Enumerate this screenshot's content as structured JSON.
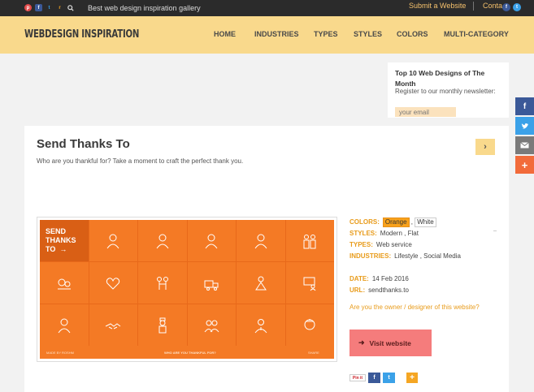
{
  "topbar": {
    "tagline": "Best web design inspiration gallery",
    "submit": "Submit a Website",
    "contact": "Conta"
  },
  "header": {
    "logo": "WEBDESIGN INSPIRATION",
    "nav": [
      "HOME",
      "INDUSTRIES",
      "TYPES",
      "STYLES",
      "COLORS",
      "MULTI-CATEGORY"
    ]
  },
  "newsletter": {
    "title": "Top 10 Web Designs of The Month",
    "text": "Register to our monthly newsletter:",
    "placeholder": "your email"
  },
  "post": {
    "title": "Send Thanks To",
    "subtitle": "Who are you thankful for? Take a moment to craft the perfect thank you.",
    "shot": {
      "headline_line1": "SEND",
      "headline_line2": "THANKS",
      "headline_line3": "TO",
      "footer_left": "MADE BY ROSHM",
      "footer_center": "WHO ARE YOU THANKFUL FOR?",
      "footer_right": "SHARE"
    },
    "colors_label": "COLORS:",
    "colors": [
      "Orange",
      "White"
    ],
    "styles_label": "STYLES:",
    "styles": "Modern , Flat",
    "types_label": "TYPES:",
    "types": "Web service",
    "industries_label": "INDUSTRIES:",
    "industries": "Lifestyle , Social Media",
    "date_label": "DATE:",
    "date": "14 Feb 2016",
    "url_label": "URL:",
    "url": "sendthanks.to",
    "owner_link": "Are you the owner / designer of this website?",
    "visit_label": "Visit website"
  },
  "share": {
    "pinterest": "Pin it"
  },
  "colors": {
    "accent": "#f9d98c",
    "orange": "#f47a25",
    "visit": "#f57c7c"
  }
}
